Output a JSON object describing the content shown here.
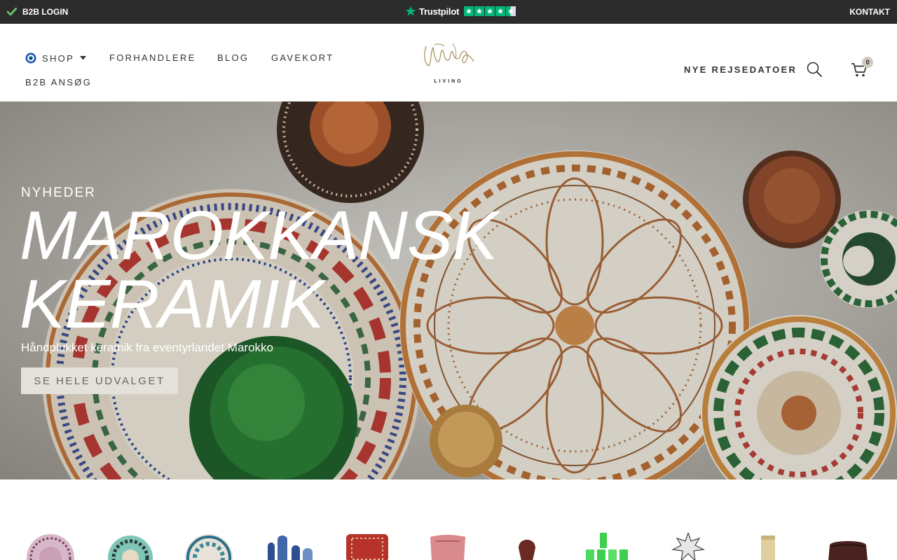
{
  "topbar": {
    "b2b_login": "B2B LOGIN",
    "trustpilot": "Trustpilot",
    "kontakt": "KONTAKT",
    "trustpilot_rating": 4.5
  },
  "nav": {
    "shop": "SHOP",
    "forhandlere": "FORHANDLERE",
    "blog": "BLOG",
    "gavekort": "GAVEKORT",
    "b2b": "B2B ANSØG",
    "rejse": "NYE REJSEDATOER"
  },
  "logo": {
    "text": "LIVING"
  },
  "cart": {
    "count": "0"
  },
  "hero": {
    "kicker": "NYHEDER",
    "title_line1": "MAROKKANSK",
    "title_line2": "KERAMIK",
    "subtitle": "Håndplukket keramik fra eventyrlandet Marokko",
    "button": "SE HELE UDVALGET"
  },
  "categories": [
    {
      "icon": "plate-icon"
    },
    {
      "icon": "teal-plate-icon"
    },
    {
      "icon": "blue-plate-icon"
    },
    {
      "icon": "vases-icon"
    },
    {
      "icon": "rug-icon"
    },
    {
      "icon": "pillow-icon"
    },
    {
      "icon": "jug-icon"
    },
    {
      "icon": "green-glasses-icon"
    },
    {
      "icon": "star-lamp-icon"
    },
    {
      "icon": "candle-icon"
    },
    {
      "icon": "pouf-icon"
    }
  ],
  "colors": {
    "topbar_bg": "#2b2c2b",
    "trustpilot_green": "#00b67a",
    "button_bg": "#e4e0da",
    "badge_bg": "#cfc9c0"
  }
}
